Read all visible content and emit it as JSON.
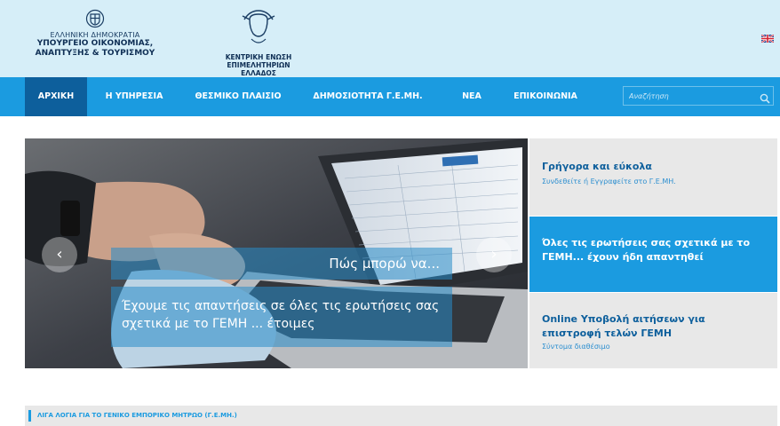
{
  "header": {
    "ministry": {
      "line1": "ΕΛΛΗΝΙΚΗ ΔΗΜΟΚΡΑΤΙΑ",
      "line2": "ΥΠΟΥΡΓΕΙΟ ΟΙΚΟΝΟΜΙΑΣ,",
      "line3": "ΑΝΑΠΤΥΞΗΣ & ΤΟΥΡΙΣΜΟΥ"
    },
    "kee": {
      "line1": "ΚΕΝΤΡΙΚΗ ΕΝΩΣΗ",
      "line2": "ΕΠΙΜΕΛΗΤΗΡΙΩΝ ΕΛΛΑΔΟΣ"
    },
    "language_icon": "uk-flag-icon"
  },
  "nav": {
    "items": [
      {
        "label": "ΑΡΧΙΚΗ",
        "active": true
      },
      {
        "label": "Η ΥΠΗΡΕΣΙΑ",
        "active": false
      },
      {
        "label": "ΘΕΣΜΙΚΟ ΠΛΑΙΣΙΟ",
        "active": false
      },
      {
        "label": "ΔΗΜΟΣΙΟΤΗΤΑ Γ.Ε.ΜΗ.",
        "active": false
      },
      {
        "label": "ΝΕΑ",
        "active": false
      },
      {
        "label": "ΕΠΙΚΟΙΝΩΝΙΑ",
        "active": false
      }
    ],
    "search": {
      "placeholder": "Αναζήτηση",
      "icon": "search-icon"
    }
  },
  "slider": {
    "caption_title": "Πώς μπορώ να...",
    "caption_body": "Έχουμε τις απαντήσεις σε όλες τις ερωτήσεις σας σχετικά με το ΓΕΜΗ ... έτοιμες",
    "prev_icon": "chevron-left-icon",
    "next_icon": "chevron-right-icon"
  },
  "panels": [
    {
      "title": "Γρήγορα και εύκολα",
      "subtitle": "Συνδεθείτε ή Εγγραφείτε στο Γ.Ε.ΜΗ."
    },
    {
      "title": "Όλες τις ερωτήσεις σας σχετικά με το ΓΕΜΗ... έχουν ήδη απαντηθεί",
      "subtitle": ""
    },
    {
      "title": "Online Υποβολή αιτήσεων για επιστροφή τελών ΓΕΜΗ",
      "subtitle": "Σύντομα διαθέσιμο"
    }
  ],
  "about": {
    "heading": "ΛΙΓΑ ΛΟΓΙΑ ΓΙΑ ΤΟ ΓΕΝΙΚΟ ΕΜΠΟΡΙΚΟ ΜΗΤΡΩΟ (Γ.Ε.ΜΗ.)"
  },
  "colors": {
    "header_bg": "#d6eef8",
    "nav_bg": "#1b9be0",
    "nav_active": "#0d5f9c",
    "panel_gray": "#e8e8e8",
    "title_blue": "#0d5f9c"
  }
}
